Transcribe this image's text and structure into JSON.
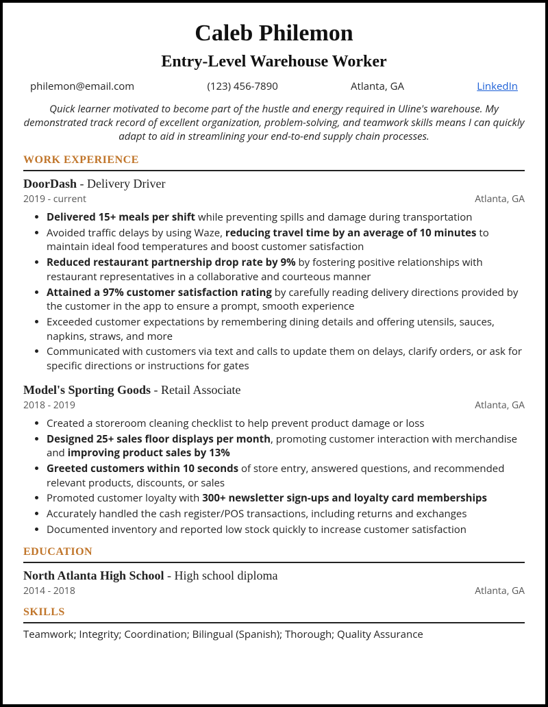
{
  "header": {
    "name": "Caleb Philemon",
    "title": "Entry-Level Warehouse Worker",
    "email": "philemon@email.com",
    "phone": "(123) 456-7890",
    "location": "Atlanta, GA",
    "linkedin": "LinkedIn"
  },
  "summary": "Quick learner motivated to become part of the hustle and energy required in Uline's warehouse. My demonstrated track record of excellent organization, problem-solving, and teamwork skills means I can quickly adapt to aid in streamlining your end-to-end supply chain processes.",
  "sections": {
    "workExperience": "WORK EXPERIENCE",
    "education": "EDUCATION",
    "skills": "SKILLS"
  },
  "jobs": [
    {
      "company": "DoorDash",
      "role": "Delivery Driver",
      "dates": "2019 - current",
      "location": "Atlanta, GA",
      "bullets": [
        {
          "bold1": "Delivered 15+ meals per shift",
          "t1": " while preventing spills and damage during transportation"
        },
        {
          "t0": "Avoided traffic delays by using Waze, ",
          "bold1": "reducing travel time by an average of 10 minutes",
          "t1": " to maintain ideal food temperatures and boost customer satisfaction"
        },
        {
          "bold1": "Reduced restaurant partnership drop rate by 9%",
          "t1": " by fostering positive relationships with restaurant representatives in a collaborative and courteous manner"
        },
        {
          "bold1": "Attained a 97% customer satisfaction rating",
          "t1": " by carefully reading delivery directions provided by the customer in the app to ensure a prompt, smooth experience"
        },
        {
          "t0": "Exceeded customer expectations by remembering dining details and offering utensils, sauces, napkins, straws, and more"
        },
        {
          "t0": "Communicated with customers via text and calls to update them on delays, clarify orders, or ask for specific directions or instructions for gates"
        }
      ]
    },
    {
      "company": "Model's Sporting Goods",
      "role": "Retail Associate",
      "dates": "2018 - 2019",
      "location": "Atlanta, GA",
      "bullets": [
        {
          "t0": "Created a storeroom cleaning checklist to help prevent product damage or loss"
        },
        {
          "bold1": "Designed 25+ sales floor displays per month",
          "t1": ", promoting customer interaction with merchandise and ",
          "bold2": "improving product sales by 13%"
        },
        {
          "bold1": "Greeted customers within 10 seconds",
          "t1": " of store entry, answered questions, and recommended relevant products, discounts, or sales"
        },
        {
          "t0": "Promoted customer loyalty with ",
          "bold1": "300+ newsletter sign-ups and loyalty card memberships"
        },
        {
          "t0": "Accurately handled the cash register/POS transactions, including returns and exchanges"
        },
        {
          "t0": "Documented inventory and reported low stock quickly to increase customer satisfaction"
        }
      ]
    }
  ],
  "education": {
    "school": "North Atlanta High School",
    "degree": "High school diploma",
    "dates": "2014 - 2018",
    "location": "Atlanta, GA"
  },
  "skills": "Teamwork; Integrity; Coordination; Bilingual (Spanish); Thorough; Quality Assurance"
}
